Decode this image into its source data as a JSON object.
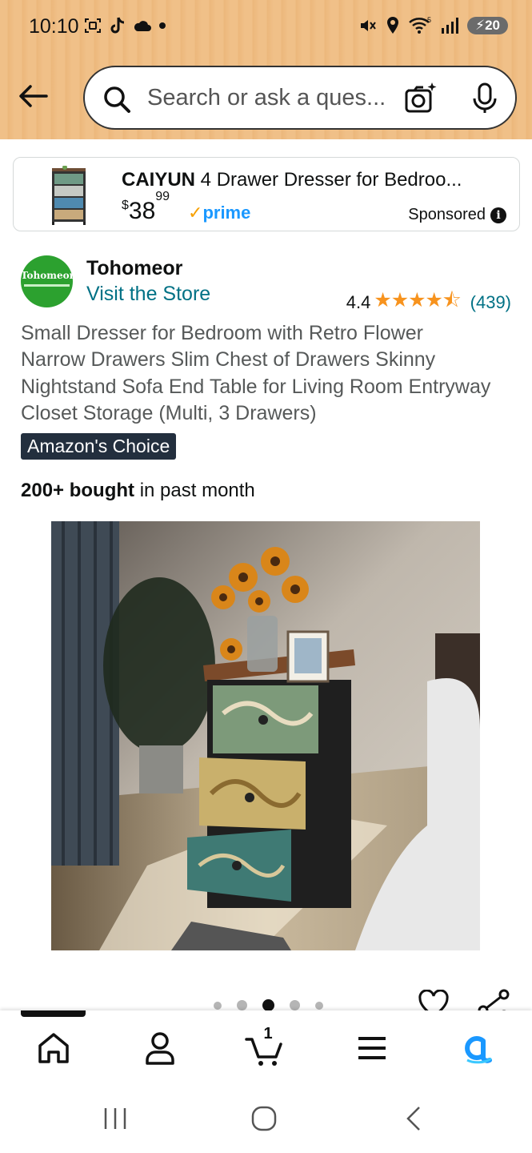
{
  "status_bar": {
    "time": "10:10",
    "battery": "20",
    "left_icons": [
      "screenshot-icon",
      "tiktok-icon",
      "cloud-icon",
      "dot-icon"
    ],
    "right_icons": [
      "mute-icon",
      "location-icon",
      "wifi-icon",
      "signal-icon",
      "battery-icon"
    ]
  },
  "search": {
    "placeholder": "Search or ask a ques..."
  },
  "sponsored_ad": {
    "brand": "CAIYUN",
    "title_rest": " 4 Drawer Dresser for Bedroo...",
    "price_currency": "$",
    "price_whole": "38",
    "price_fraction": "99",
    "prime_label": "prime",
    "sponsored_label": "Sponsored",
    "info_glyph": "i"
  },
  "store": {
    "logo_text": "Tohomeor",
    "name": "Tohomeor",
    "visit_label": "Visit the Store",
    "rating": "4.4",
    "stars_value": 4.4,
    "stars_display": "★★★★⯪",
    "review_count": "(439)"
  },
  "product": {
    "title": "Small Dresser for Bedroom with Retro Flower Narrow Drawers Slim Chest of Drawers Skinny Nightstand Sofa End Table for Living Room Entryway Closet Storage (Multi, 3 Drawers)",
    "badge": "Amazon's Choice",
    "bought_bold": "200+ bought",
    "bought_rest": " in past month"
  },
  "carousel": {
    "total": 5,
    "active_index": 2
  },
  "bottom_nav": {
    "items": [
      "home",
      "account",
      "cart",
      "menu",
      "rufus"
    ],
    "cart_count": "1"
  },
  "colors": {
    "header_bg": "#f0c088",
    "link": "#007185",
    "star": "#f7931e",
    "badge_bg": "#232f3e",
    "prime": "#1a98ff"
  }
}
